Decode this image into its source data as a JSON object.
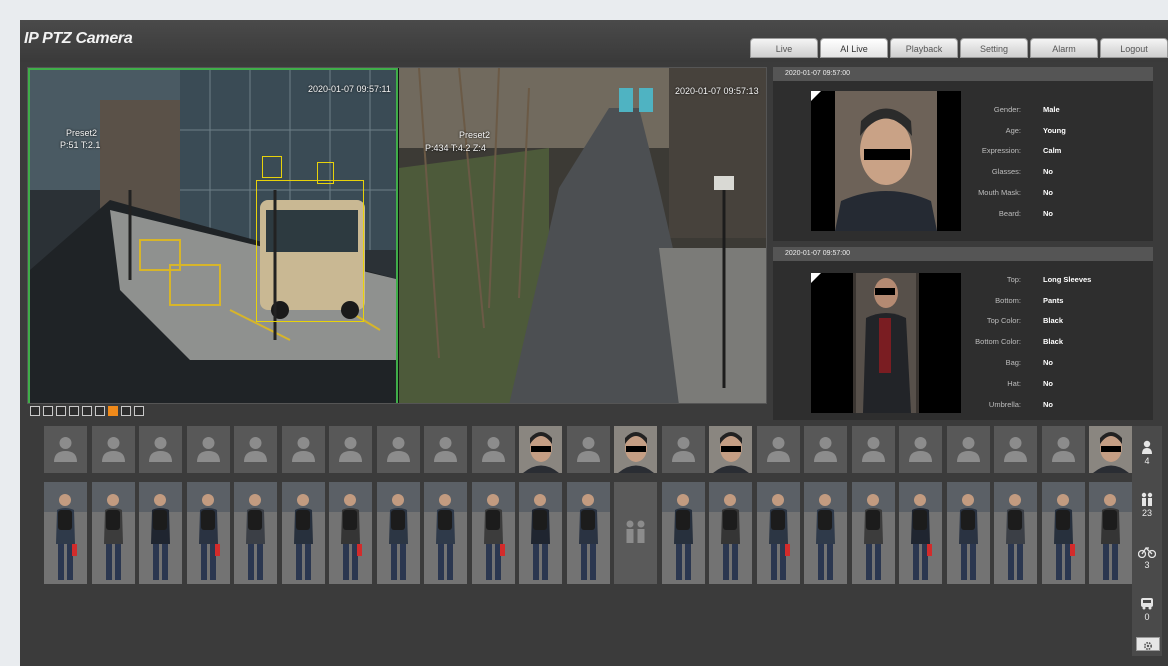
{
  "header": {
    "brand": "IP PTZ Camera",
    "tabs": [
      {
        "label": "Live",
        "active": false
      },
      {
        "label": "AI Live",
        "active": true
      },
      {
        "label": "Playback",
        "active": false
      },
      {
        "label": "Setting",
        "active": false
      },
      {
        "label": "Alarm",
        "active": false
      },
      {
        "label": "Logout",
        "active": false
      }
    ]
  },
  "live": {
    "left": {
      "preset": "Preset2",
      "position": "P:51 T:2.1",
      "timestamp": "2020-01-07 09:57:11"
    },
    "right": {
      "preset": "Preset2",
      "position": "P:434 T:4.2 Z:4",
      "timestamp": "2020-01-07 09:57:13"
    },
    "toolbar_icons": [
      "fullscreen-icon",
      "split-icon",
      "pip-icon",
      "fisheye-icon",
      "layout-1-icon",
      "layout-2-icon",
      "layout-3-icon",
      "layout-4-icon",
      "layout-5-icon"
    ],
    "active_tool": 7
  },
  "face_panel": {
    "timestamp": "2020-01-07 09:57:00",
    "attributes": [
      {
        "label": "Gender:",
        "value": "Male"
      },
      {
        "label": "Age:",
        "value": "Young"
      },
      {
        "label": "Expression:",
        "value": "Calm"
      },
      {
        "label": "Glasses:",
        "value": "No"
      },
      {
        "label": "Mouth Mask:",
        "value": "No"
      },
      {
        "label": "Beard:",
        "value": "No"
      }
    ]
  },
  "body_panel": {
    "timestamp": "2020-01-07 09:57:00",
    "attributes": [
      {
        "label": "Top:",
        "value": "Long Sleeves"
      },
      {
        "label": "Bottom:",
        "value": "Pants"
      },
      {
        "label": "Top Color:",
        "value": "Black"
      },
      {
        "label": "Bottom Color:",
        "value": "Black"
      },
      {
        "label": "Bag:",
        "value": "No"
      },
      {
        "label": "Hat:",
        "value": "No"
      },
      {
        "label": "Umbrella:",
        "value": "No"
      }
    ]
  },
  "stats": [
    {
      "icon": "person-icon",
      "count": "4"
    },
    {
      "icon": "pedestrian-icon",
      "count": "23"
    },
    {
      "icon": "bicycle-icon",
      "count": "3"
    },
    {
      "icon": "vehicle-icon",
      "count": "0"
    }
  ],
  "settings_icon": "gear-icon",
  "colors": {
    "accent": "#f08a1a",
    "selection": "#3fae49",
    "bbox": "#e7d20b"
  }
}
